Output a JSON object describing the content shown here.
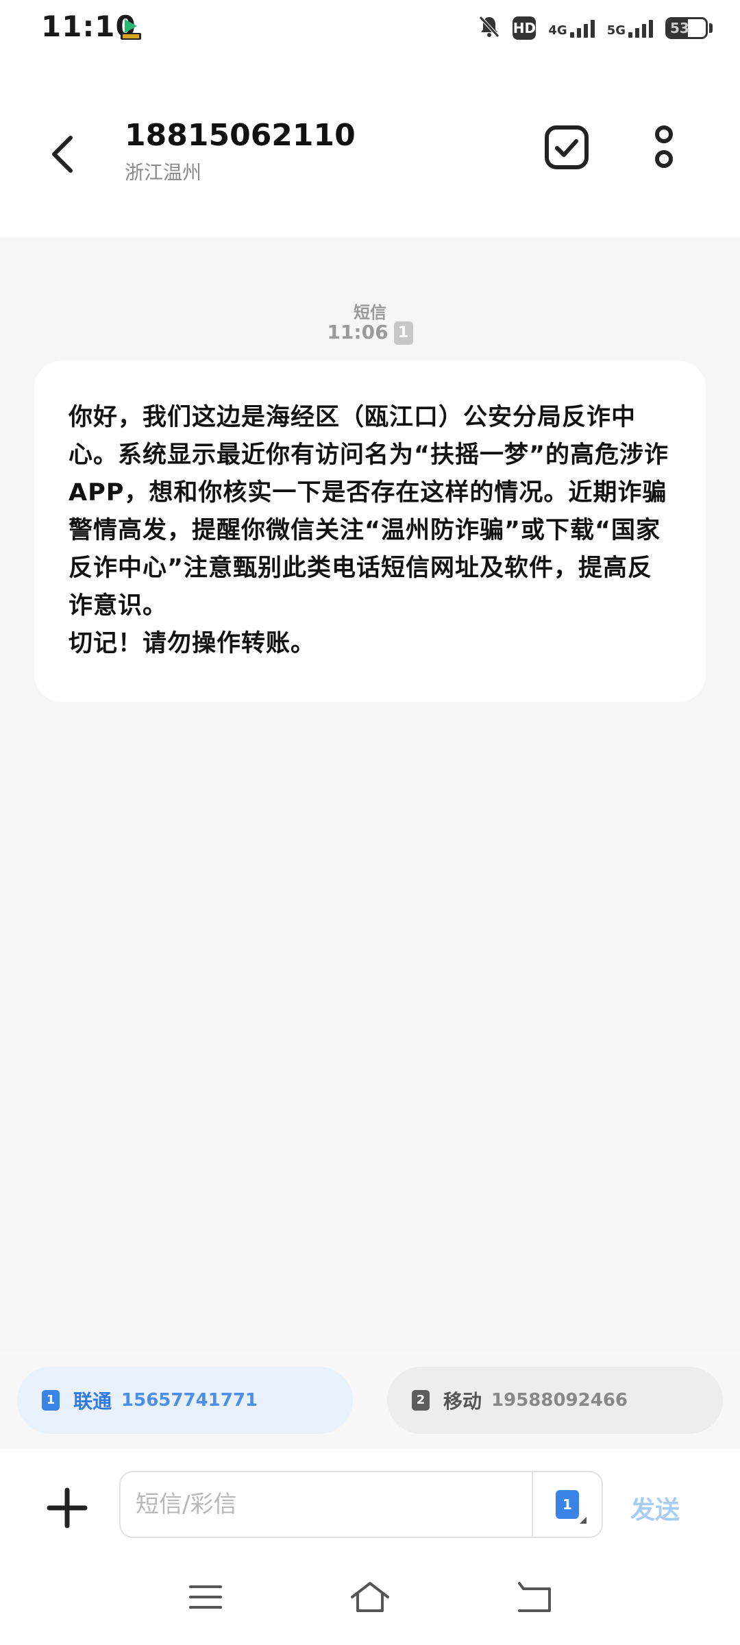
{
  "status_bar": {
    "time": "11:10",
    "hd_label": "HD",
    "network_1": "4G",
    "network_2": "5G",
    "battery": "53",
    "battery_level": 0.53,
    "icons": [
      "app-notification-icon",
      "mute-bell-icon",
      "hd-call-icon",
      "signal-4g-icon",
      "signal-5g-icon",
      "battery-icon"
    ]
  },
  "header": {
    "contact_number": "18815062110",
    "location": "浙江温州",
    "icons": [
      "back-arrow-icon",
      "multi-select-icon",
      "more-options-icon"
    ]
  },
  "message": {
    "type_label": "短信",
    "time": "11:06",
    "sim_slot": "1",
    "body": "你好，我们这边是海经区（瓯江口）公安分局反诈中心。系统显示最近你有访问名为“扶摇一梦”的高危涉诈APP，想和你核实一下是否存在这样的情况。近期诈骗警情高发，提醒你微信关注“温州防诈骗”或下载“国家反诈中心”注意甄别此类电话短信网址及软件，提高反诈意识。\n切记！请勿操作转账。"
  },
  "sim_selector": {
    "sims": [
      {
        "slot": "1",
        "carrier": "联通",
        "number": "15657741771",
        "selected": true
      },
      {
        "slot": "2",
        "carrier": "移动",
        "number": "19588092466",
        "selected": false
      }
    ],
    "accent_color": "#3a84e8"
  },
  "compose": {
    "placeholder": "短信/彩信",
    "sim_slot": "1",
    "send_label": "发送",
    "send_color": "#a9ccf5",
    "icons": [
      "plus-icon",
      "sim-select-icon"
    ]
  },
  "nav_bar": {
    "icons": [
      "menu-lines-icon",
      "home-icon",
      "back-icon"
    ]
  }
}
